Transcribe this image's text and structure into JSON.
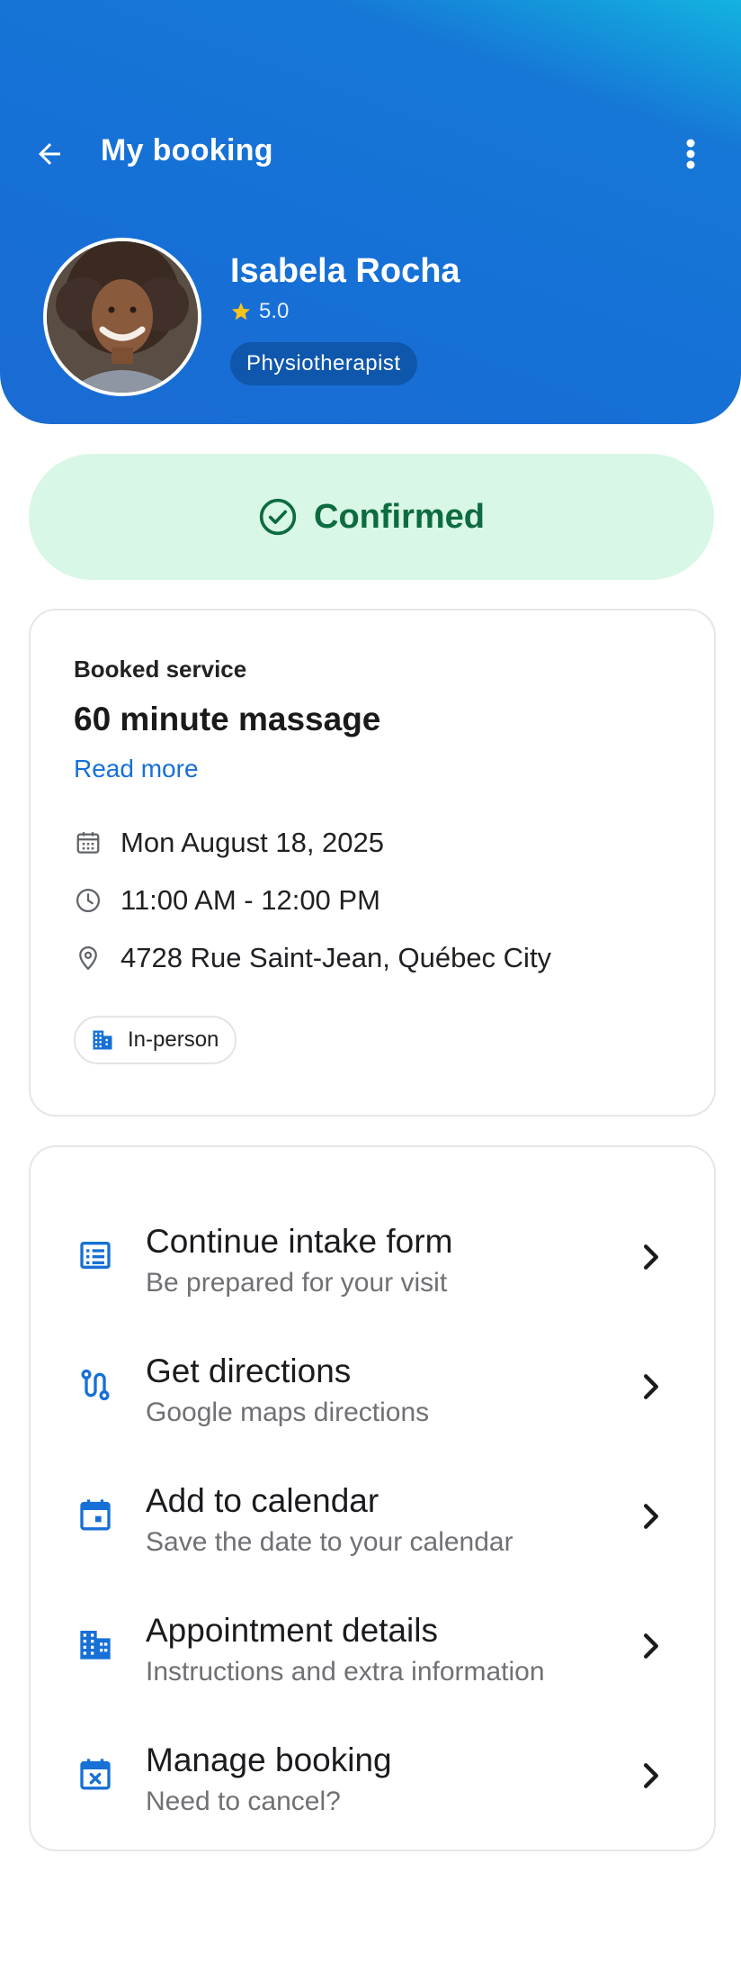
{
  "header": {
    "title": "My booking",
    "back_icon": "arrow-left-icon",
    "more_icon": "more-vertical-icon"
  },
  "professional": {
    "name": "Isabela Rocha",
    "rating": "5.0",
    "role": "Physiotherapist"
  },
  "status": {
    "label": "Confirmed",
    "color": "#0d6b3f",
    "background": "#d8f7e6"
  },
  "service": {
    "section_label": "Booked service",
    "title": "60 minute massage",
    "read_more": "Read more",
    "date": "Mon August 18, 2025",
    "time": "11:00 AM - 12:00 PM",
    "address": "4728 Rue Saint-Jean, Québec City",
    "mode": "In-person"
  },
  "actions": [
    {
      "title": "Continue intake form",
      "subtitle": "Be prepared for your visit",
      "icon": "list-icon"
    },
    {
      "title": "Get directions",
      "subtitle": "Google maps directions",
      "icon": "route-icon"
    },
    {
      "title": "Add to calendar",
      "subtitle": "Save the date to your calendar",
      "icon": "calendar-icon"
    },
    {
      "title": "Appointment details",
      "subtitle": "Instructions and extra information",
      "icon": "building-icon"
    },
    {
      "title": "Manage booking",
      "subtitle": "Need to cancel?",
      "icon": "calendar-cancel-icon"
    }
  ],
  "colors": {
    "primary": "#1670d6",
    "accent_star": "#f7c21a"
  }
}
